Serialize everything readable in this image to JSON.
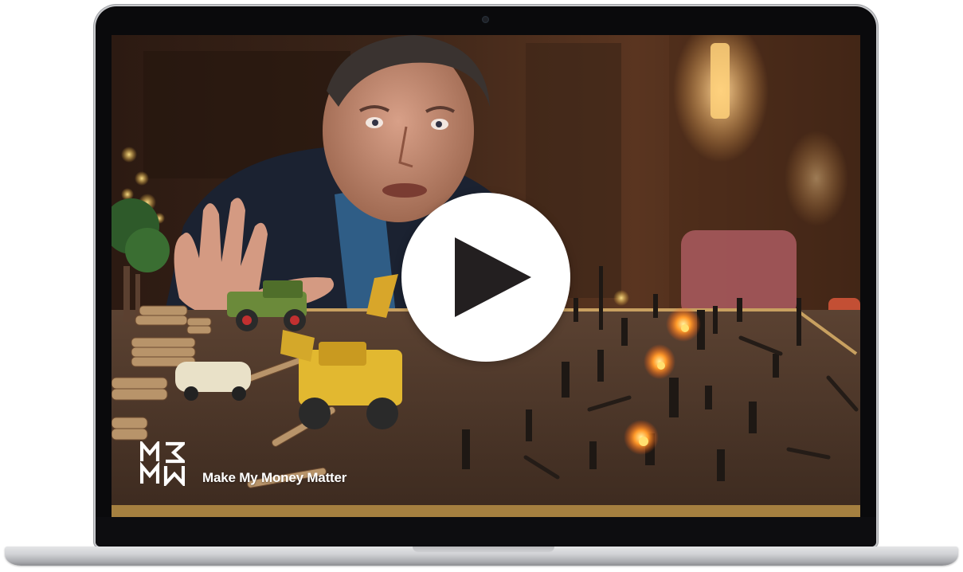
{
  "video": {
    "brand_name": "Make My Money Matter",
    "logo_letters": [
      "M",
      "M",
      "M",
      "M"
    ],
    "play_icon": "play-icon",
    "colors": {
      "brand_text": "#ffffff",
      "play_button": "#ffffff",
      "play_triangle": "#231f20"
    }
  },
  "device": {
    "type": "laptop",
    "color": "#c8c9cc"
  }
}
